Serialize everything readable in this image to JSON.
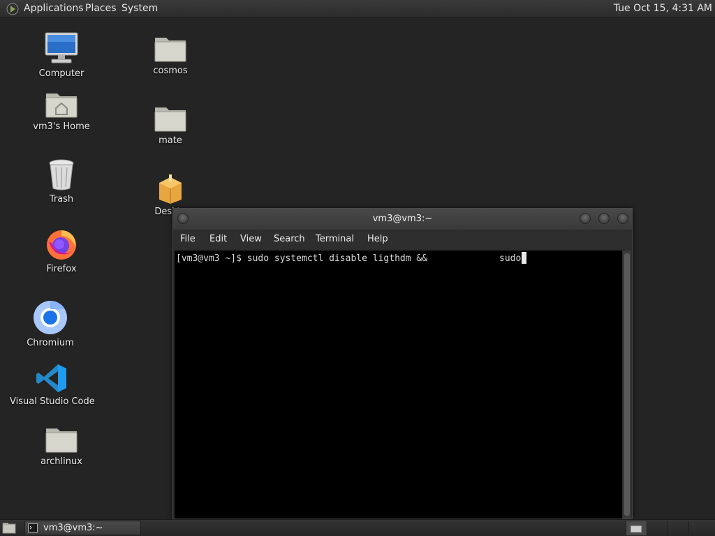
{
  "top_panel": {
    "menus": [
      "Applications",
      "Places",
      "System"
    ],
    "clock": "Tue Oct 15,  4:31 AM",
    "icons": {
      "logo": "mate-logo-icon"
    }
  },
  "desktop": {
    "icons": [
      {
        "label": "Computer",
        "icon": "computer-icon"
      },
      {
        "label": "vm3's Home",
        "icon": "home-folder-icon"
      },
      {
        "label": "Trash",
        "icon": "trash-icon"
      },
      {
        "label": "Firefox",
        "icon": "firefox-icon"
      },
      {
        "label": "Chromium",
        "icon": "chromium-icon"
      },
      {
        "label": "Visual Studio Code",
        "icon": "vscode-icon"
      },
      {
        "label": "archlinux",
        "icon": "folder-icon"
      },
      {
        "label": "cosmos",
        "icon": "folder-icon"
      },
      {
        "label": "mate",
        "icon": "folder-icon"
      },
      {
        "label": "Deskto",
        "icon": "package-icon"
      }
    ]
  },
  "terminal": {
    "title": "vm3@vm3:~",
    "menu": [
      "File",
      "Edit",
      "View",
      "Search",
      "Terminal",
      "Help"
    ],
    "prompt_line": "[vm3@vm3 ~]$ sudo systemctl disable ligthdm &&",
    "trailing_input": "sudo"
  },
  "bottom_panel": {
    "taskbar_items": [
      {
        "label": "vm3@vm3:~",
        "icon": "terminal-icon"
      }
    ]
  },
  "colors": {
    "desktop_bg": "#242424",
    "terminal_bg": "#000000",
    "terminal_fg": "#d8d8d8"
  }
}
